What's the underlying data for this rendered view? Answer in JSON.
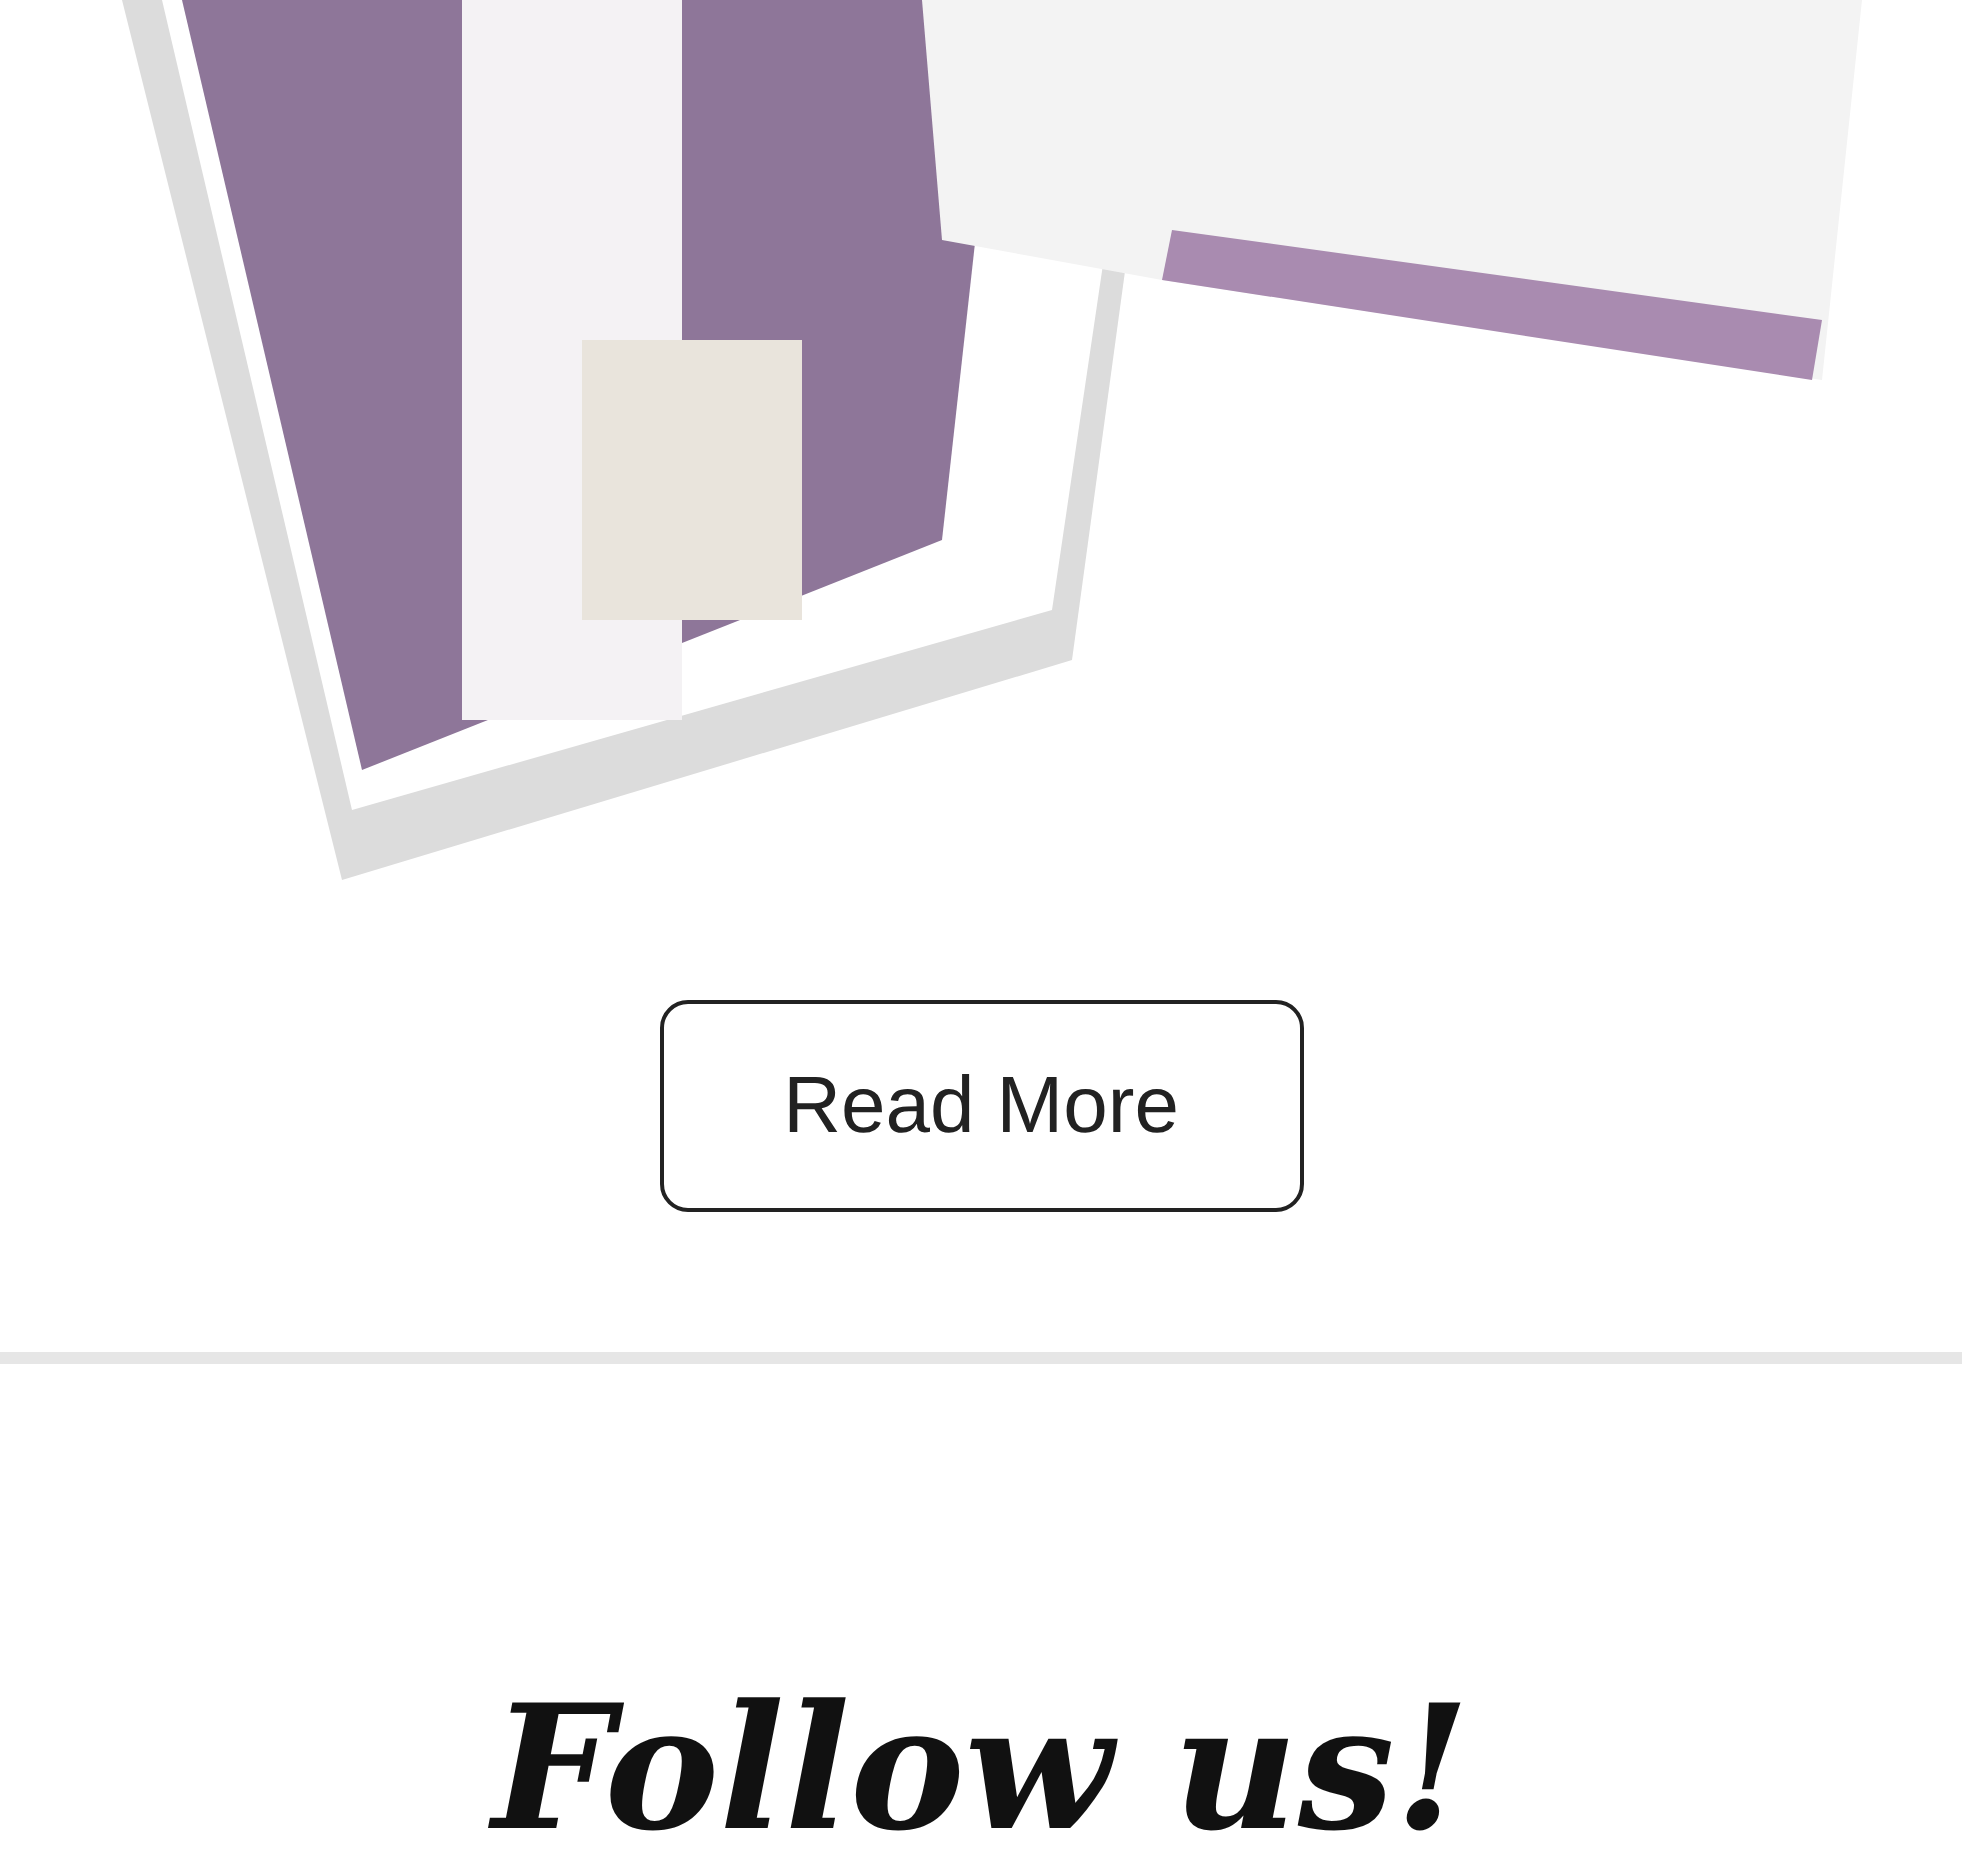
{
  "read_more_button": {
    "label": "Read More"
  },
  "follow_heading": {
    "text": "Follow us!"
  }
}
